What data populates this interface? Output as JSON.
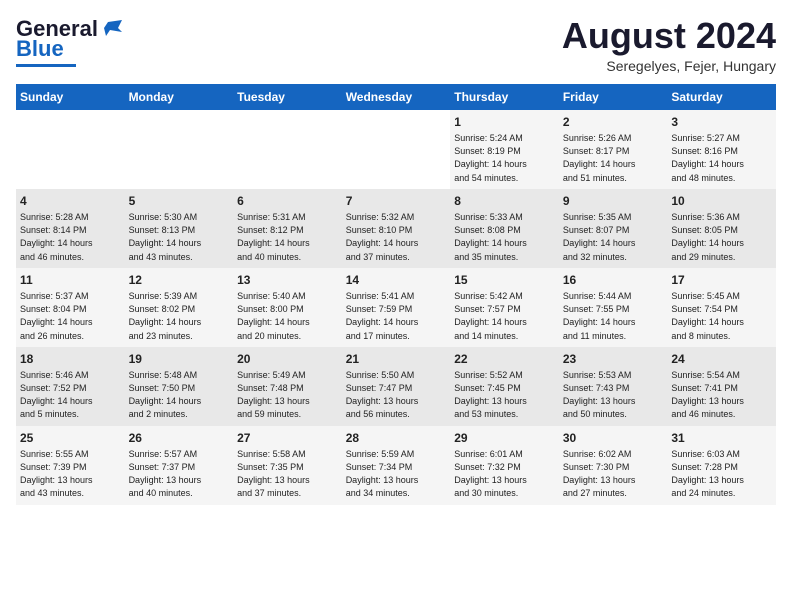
{
  "header": {
    "logo_general": "General",
    "logo_blue": "Blue",
    "month_year": "August 2024",
    "location": "Seregelyes, Fejer, Hungary"
  },
  "days_of_week": [
    "Sunday",
    "Monday",
    "Tuesday",
    "Wednesday",
    "Thursday",
    "Friday",
    "Saturday"
  ],
  "weeks": [
    [
      {
        "num": "",
        "info": ""
      },
      {
        "num": "",
        "info": ""
      },
      {
        "num": "",
        "info": ""
      },
      {
        "num": "",
        "info": ""
      },
      {
        "num": "1",
        "info": "Sunrise: 5:24 AM\nSunset: 8:19 PM\nDaylight: 14 hours\nand 54 minutes."
      },
      {
        "num": "2",
        "info": "Sunrise: 5:26 AM\nSunset: 8:17 PM\nDaylight: 14 hours\nand 51 minutes."
      },
      {
        "num": "3",
        "info": "Sunrise: 5:27 AM\nSunset: 8:16 PM\nDaylight: 14 hours\nand 48 minutes."
      }
    ],
    [
      {
        "num": "4",
        "info": "Sunrise: 5:28 AM\nSunset: 8:14 PM\nDaylight: 14 hours\nand 46 minutes."
      },
      {
        "num": "5",
        "info": "Sunrise: 5:30 AM\nSunset: 8:13 PM\nDaylight: 14 hours\nand 43 minutes."
      },
      {
        "num": "6",
        "info": "Sunrise: 5:31 AM\nSunset: 8:12 PM\nDaylight: 14 hours\nand 40 minutes."
      },
      {
        "num": "7",
        "info": "Sunrise: 5:32 AM\nSunset: 8:10 PM\nDaylight: 14 hours\nand 37 minutes."
      },
      {
        "num": "8",
        "info": "Sunrise: 5:33 AM\nSunset: 8:08 PM\nDaylight: 14 hours\nand 35 minutes."
      },
      {
        "num": "9",
        "info": "Sunrise: 5:35 AM\nSunset: 8:07 PM\nDaylight: 14 hours\nand 32 minutes."
      },
      {
        "num": "10",
        "info": "Sunrise: 5:36 AM\nSunset: 8:05 PM\nDaylight: 14 hours\nand 29 minutes."
      }
    ],
    [
      {
        "num": "11",
        "info": "Sunrise: 5:37 AM\nSunset: 8:04 PM\nDaylight: 14 hours\nand 26 minutes."
      },
      {
        "num": "12",
        "info": "Sunrise: 5:39 AM\nSunset: 8:02 PM\nDaylight: 14 hours\nand 23 minutes."
      },
      {
        "num": "13",
        "info": "Sunrise: 5:40 AM\nSunset: 8:00 PM\nDaylight: 14 hours\nand 20 minutes."
      },
      {
        "num": "14",
        "info": "Sunrise: 5:41 AM\nSunset: 7:59 PM\nDaylight: 14 hours\nand 17 minutes."
      },
      {
        "num": "15",
        "info": "Sunrise: 5:42 AM\nSunset: 7:57 PM\nDaylight: 14 hours\nand 14 minutes."
      },
      {
        "num": "16",
        "info": "Sunrise: 5:44 AM\nSunset: 7:55 PM\nDaylight: 14 hours\nand 11 minutes."
      },
      {
        "num": "17",
        "info": "Sunrise: 5:45 AM\nSunset: 7:54 PM\nDaylight: 14 hours\nand 8 minutes."
      }
    ],
    [
      {
        "num": "18",
        "info": "Sunrise: 5:46 AM\nSunset: 7:52 PM\nDaylight: 14 hours\nand 5 minutes."
      },
      {
        "num": "19",
        "info": "Sunrise: 5:48 AM\nSunset: 7:50 PM\nDaylight: 14 hours\nand 2 minutes."
      },
      {
        "num": "20",
        "info": "Sunrise: 5:49 AM\nSunset: 7:48 PM\nDaylight: 13 hours\nand 59 minutes."
      },
      {
        "num": "21",
        "info": "Sunrise: 5:50 AM\nSunset: 7:47 PM\nDaylight: 13 hours\nand 56 minutes."
      },
      {
        "num": "22",
        "info": "Sunrise: 5:52 AM\nSunset: 7:45 PM\nDaylight: 13 hours\nand 53 minutes."
      },
      {
        "num": "23",
        "info": "Sunrise: 5:53 AM\nSunset: 7:43 PM\nDaylight: 13 hours\nand 50 minutes."
      },
      {
        "num": "24",
        "info": "Sunrise: 5:54 AM\nSunset: 7:41 PM\nDaylight: 13 hours\nand 46 minutes."
      }
    ],
    [
      {
        "num": "25",
        "info": "Sunrise: 5:55 AM\nSunset: 7:39 PM\nDaylight: 13 hours\nand 43 minutes."
      },
      {
        "num": "26",
        "info": "Sunrise: 5:57 AM\nSunset: 7:37 PM\nDaylight: 13 hours\nand 40 minutes."
      },
      {
        "num": "27",
        "info": "Sunrise: 5:58 AM\nSunset: 7:35 PM\nDaylight: 13 hours\nand 37 minutes."
      },
      {
        "num": "28",
        "info": "Sunrise: 5:59 AM\nSunset: 7:34 PM\nDaylight: 13 hours\nand 34 minutes."
      },
      {
        "num": "29",
        "info": "Sunrise: 6:01 AM\nSunset: 7:32 PM\nDaylight: 13 hours\nand 30 minutes."
      },
      {
        "num": "30",
        "info": "Sunrise: 6:02 AM\nSunset: 7:30 PM\nDaylight: 13 hours\nand 27 minutes."
      },
      {
        "num": "31",
        "info": "Sunrise: 6:03 AM\nSunset: 7:28 PM\nDaylight: 13 hours\nand 24 minutes."
      }
    ]
  ]
}
